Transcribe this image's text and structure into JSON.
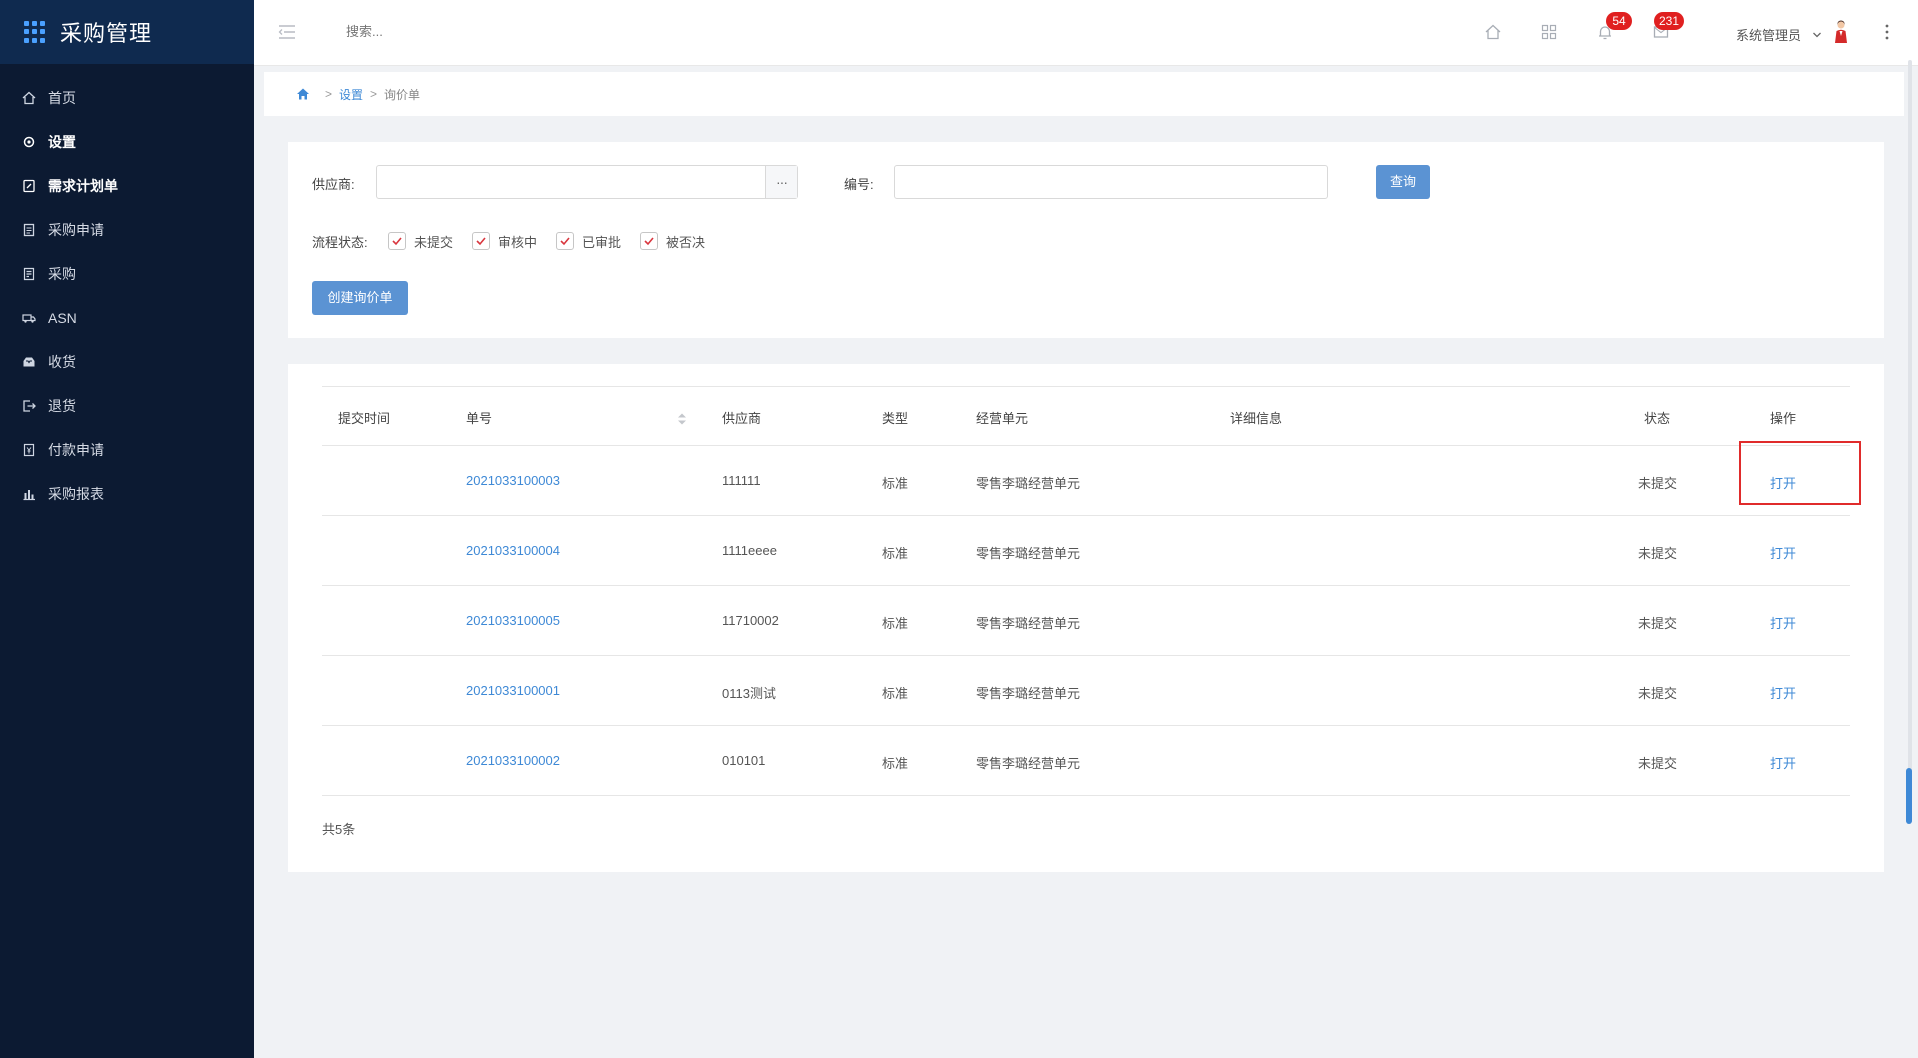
{
  "app": {
    "title": "采购管理"
  },
  "sidebar": {
    "items": [
      {
        "label": "首页",
        "icon": "home-icon",
        "bold": false
      },
      {
        "label": "设置",
        "icon": "gear-icon",
        "bold": true
      },
      {
        "label": "需求计划单",
        "icon": "edit-doc-icon",
        "bold": true
      },
      {
        "label": "采购申请",
        "icon": "clipboard-icon",
        "bold": false
      },
      {
        "label": "采购",
        "icon": "receipt-icon",
        "bold": false
      },
      {
        "label": "ASN",
        "icon": "truck-icon",
        "bold": false
      },
      {
        "label": "收货",
        "icon": "inbox-icon",
        "bold": false
      },
      {
        "label": "退货",
        "icon": "return-icon",
        "bold": false
      },
      {
        "label": "付款申请",
        "icon": "payment-doc-icon",
        "bold": false
      },
      {
        "label": "采购报表",
        "icon": "bar-chart-icon",
        "bold": false
      }
    ]
  },
  "header": {
    "search_placeholder": "搜索...",
    "notification_count": "54",
    "message_count": "231",
    "user_name": "系统管理员"
  },
  "breadcrumb": {
    "level1": "设置",
    "level2": "询价单",
    "separator": ">"
  },
  "filter": {
    "supplier_label": "供应商:",
    "supplier_value": "",
    "supplier_addon": "···",
    "code_label": "编号:",
    "code_value": "",
    "query_button": "查询",
    "status_label": "流程状态:",
    "statuses": [
      {
        "label": "未提交",
        "checked": true
      },
      {
        "label": "审核中",
        "checked": true
      },
      {
        "label": "已审批",
        "checked": true
      },
      {
        "label": "被否决",
        "checked": true
      }
    ],
    "create_button": "创建询价单"
  },
  "table": {
    "columns": [
      "提交时间",
      "单号",
      "供应商",
      "类型",
      "经营单元",
      "详细信息",
      "状态",
      "操作"
    ],
    "rows": [
      {
        "submit_time": "",
        "code": "2021033100003",
        "supplier": "111111",
        "type": "标准",
        "unit": "零售李璐经营单元",
        "detail": "",
        "status": "未提交",
        "action": "打开"
      },
      {
        "submit_time": "",
        "code": "2021033100004",
        "supplier": "1111eeee",
        "type": "标准",
        "unit": "零售李璐经营单元",
        "detail": "",
        "status": "未提交",
        "action": "打开"
      },
      {
        "submit_time": "",
        "code": "2021033100005",
        "supplier": "11710002",
        "type": "标准",
        "unit": "零售李璐经营单元",
        "detail": "",
        "status": "未提交",
        "action": "打开"
      },
      {
        "submit_time": "",
        "code": "2021033100001",
        "supplier": "0113测试",
        "type": "标准",
        "unit": "零售李璐经营单元",
        "detail": "",
        "status": "未提交",
        "action": "打开"
      },
      {
        "submit_time": "",
        "code": "2021033100002",
        "supplier": "010101",
        "type": "标准",
        "unit": "零售李璐经营单元",
        "detail": "",
        "status": "未提交",
        "action": "打开"
      }
    ],
    "total": "共5条"
  },
  "colors": {
    "sidebar_bg": "#0c1a32",
    "sidebar_header_bg": "#0f2a4f",
    "accent": "#3e89d6",
    "button": "#5b93d3",
    "badge": "#e02020",
    "highlight": "#e02b2b"
  }
}
